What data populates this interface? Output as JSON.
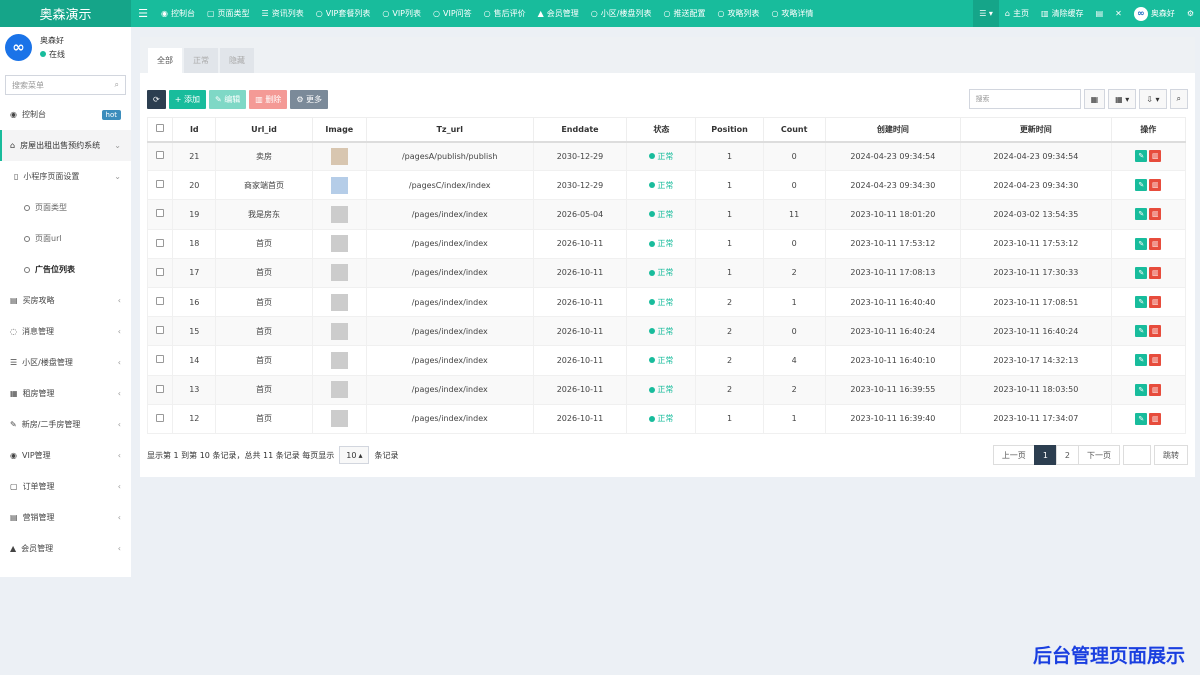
{
  "brand": "奥森演示",
  "topnav": [
    {
      "icon": "dashboard-icon",
      "glyph": "◉",
      "label": "控制台"
    },
    {
      "icon": "file-icon",
      "glyph": "▢",
      "label": "页面类型"
    },
    {
      "icon": "list-icon",
      "glyph": "☰",
      "label": "资讯列表"
    },
    {
      "icon": "circle-icon",
      "glyph": "○",
      "label": "VIP套餐列表"
    },
    {
      "icon": "circle-icon",
      "glyph": "○",
      "label": "VIP列表"
    },
    {
      "icon": "circle-icon",
      "glyph": "○",
      "label": "VIP问答"
    },
    {
      "icon": "circle-icon",
      "glyph": "○",
      "label": "售后评价"
    },
    {
      "icon": "user-icon",
      "glyph": "▲",
      "label": "会员管理"
    },
    {
      "icon": "circle-icon",
      "glyph": "○",
      "label": "小区/楼盘列表"
    },
    {
      "icon": "circle-icon",
      "glyph": "○",
      "label": "推送配置"
    },
    {
      "icon": "circle-icon",
      "glyph": "○",
      "label": "攻略列表"
    },
    {
      "icon": "circle-icon",
      "glyph": "○",
      "label": "攻略详情"
    }
  ],
  "topright": {
    "home": "主页",
    "clear_cache": "清除缓存",
    "user": "奥森好",
    "avatar_glyph": "∞"
  },
  "sidebar": {
    "username": "奥森好",
    "status": "在线",
    "avatar_glyph": "∞",
    "search_placeholder": "搜索菜单",
    "items": [
      {
        "label": "控制台",
        "icon": "dashboard-icon",
        "glyph": "◉",
        "badge": "hot"
      },
      {
        "label": "房屋出租出售预约系统",
        "icon": "home-icon",
        "glyph": "⌂",
        "arrow": "⌄"
      },
      {
        "label": "小程序页面设置",
        "icon": "bookmark-icon",
        "glyph": "▯",
        "arrow": "⌄"
      },
      {
        "label": "页面类型"
      },
      {
        "label": "页面url"
      },
      {
        "label": "广告位列表"
      },
      {
        "label": "买房攻略",
        "icon": "copy-icon",
        "glyph": "▤",
        "arrow": "‹"
      },
      {
        "label": "消息管理",
        "icon": "comment-icon",
        "glyph": "◌",
        "arrow": "‹"
      },
      {
        "label": "小区/楼盘管理",
        "icon": "list-icon",
        "glyph": "☰",
        "arrow": "‹"
      },
      {
        "label": "租房管理",
        "icon": "building-icon",
        "glyph": "▦",
        "arrow": "‹"
      },
      {
        "label": "新房/二手房管理",
        "icon": "key-icon",
        "glyph": "✎",
        "arrow": "‹"
      },
      {
        "label": "VIP管理",
        "icon": "vip-icon",
        "glyph": "◉",
        "arrow": "‹"
      },
      {
        "label": "订单管理",
        "icon": "order-icon",
        "glyph": "▢",
        "arrow": "‹"
      },
      {
        "label": "营销管理",
        "icon": "table-icon",
        "glyph": "▤",
        "arrow": "‹"
      },
      {
        "label": "会员管理",
        "icon": "user-icon",
        "glyph": "▲",
        "arrow": "‹"
      }
    ]
  },
  "tabs": [
    "全部",
    "正常",
    "隐藏"
  ],
  "toolbar": {
    "refresh": "⟳",
    "add": "+ 添加",
    "edit": "✎ 编辑",
    "delete": "▥ 删除",
    "more": "⚙ 更多",
    "search_placeholder": "搜索"
  },
  "table": {
    "headers": [
      "Id",
      "Url_id",
      "Image",
      "Tz_url",
      "Enddate",
      "状态",
      "Position",
      "Count",
      "创建时间",
      "更新时间",
      "操作"
    ],
    "status_label": "正常",
    "rows": [
      {
        "id": "21",
        "url_id": "卖房",
        "image": "t1",
        "tz_url": "/pagesA/publish/publish",
        "enddate": "2030-12-29",
        "position": "1",
        "count": "0",
        "created": "2024-04-23 09:34:54",
        "updated": "2024-04-23 09:34:54"
      },
      {
        "id": "20",
        "url_id": "商家端首页",
        "image": "t2",
        "tz_url": "/pagesC/index/index",
        "enddate": "2030-12-29",
        "position": "1",
        "count": "0",
        "created": "2024-04-23 09:34:30",
        "updated": "2024-04-23 09:34:30"
      },
      {
        "id": "19",
        "url_id": "我是房东",
        "image": "t0",
        "tz_url": "/pages/index/index",
        "enddate": "2026-05-04",
        "position": "1",
        "count": "11",
        "created": "2023-10-11 18:01:20",
        "updated": "2024-03-02 13:54:35"
      },
      {
        "id": "18",
        "url_id": "首页",
        "image": "t0",
        "tz_url": "/pages/index/index",
        "enddate": "2026-10-11",
        "position": "1",
        "count": "0",
        "created": "2023-10-11 17:53:12",
        "updated": "2023-10-11 17:53:12"
      },
      {
        "id": "17",
        "url_id": "首页",
        "image": "t0",
        "tz_url": "/pages/index/index",
        "enddate": "2026-10-11",
        "position": "1",
        "count": "2",
        "created": "2023-10-11 17:08:13",
        "updated": "2023-10-11 17:30:33"
      },
      {
        "id": "16",
        "url_id": "首页",
        "image": "t0",
        "tz_url": "/pages/index/index",
        "enddate": "2026-10-11",
        "position": "2",
        "count": "1",
        "created": "2023-10-11 16:40:40",
        "updated": "2023-10-11 17:08:51"
      },
      {
        "id": "15",
        "url_id": "首页",
        "image": "t0",
        "tz_url": "/pages/index/index",
        "enddate": "2026-10-11",
        "position": "2",
        "count": "0",
        "created": "2023-10-11 16:40:24",
        "updated": "2023-10-11 16:40:24"
      },
      {
        "id": "14",
        "url_id": "首页",
        "image": "t0",
        "tz_url": "/pages/index/index",
        "enddate": "2026-10-11",
        "position": "2",
        "count": "4",
        "created": "2023-10-11 16:40:10",
        "updated": "2023-10-17 14:32:13"
      },
      {
        "id": "13",
        "url_id": "首页",
        "image": "t0",
        "tz_url": "/pages/index/index",
        "enddate": "2026-10-11",
        "position": "2",
        "count": "2",
        "created": "2023-10-11 16:39:55",
        "updated": "2023-10-11 18:03:50"
      },
      {
        "id": "12",
        "url_id": "首页",
        "image": "t0",
        "tz_url": "/pages/index/index",
        "enddate": "2026-10-11",
        "position": "1",
        "count": "1",
        "created": "2023-10-11 16:39:40",
        "updated": "2023-10-11 17:34:07"
      }
    ]
  },
  "footer": {
    "summary": "显示第 1 到第 10 条记录，总共 11 条记录 每页显示",
    "page_size": "10",
    "suffix": "条记录"
  },
  "pager": {
    "prev": "上一页",
    "pages": [
      "1",
      "2"
    ],
    "current": "1",
    "next": "下一页",
    "jump": "跳转"
  },
  "promo": "后台管理页面展示"
}
